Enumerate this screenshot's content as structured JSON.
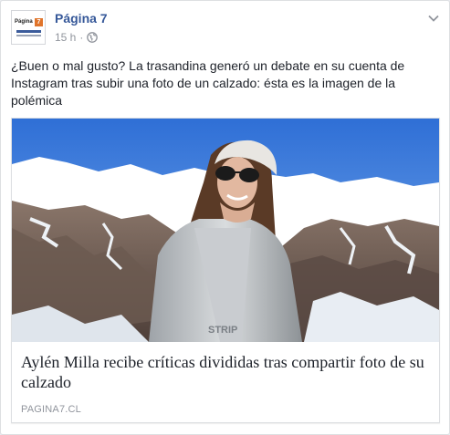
{
  "post": {
    "page_name": "Página 7",
    "timestamp": "15 h",
    "separator": "·",
    "text": "¿Buen o mal gusto? La trasandina generó un debate en su cuenta de Instagram tras subir una foto de un calzado: ésta es la imagen de la polémica",
    "avatar": {
      "logo_text": "Página",
      "logo_number": "7"
    },
    "icons": {
      "privacy": "globe-icon",
      "menu": "chevron-down-icon"
    }
  },
  "link_card": {
    "title": "Aylén Milla recibe críticas divididas tras compartir foto de su calzado",
    "domain": "PAGINA7.CL"
  },
  "colors": {
    "link_blue": "#365899",
    "meta_gray": "#90949c",
    "text": "#1d2129",
    "logo_orange": "#e0742a"
  }
}
